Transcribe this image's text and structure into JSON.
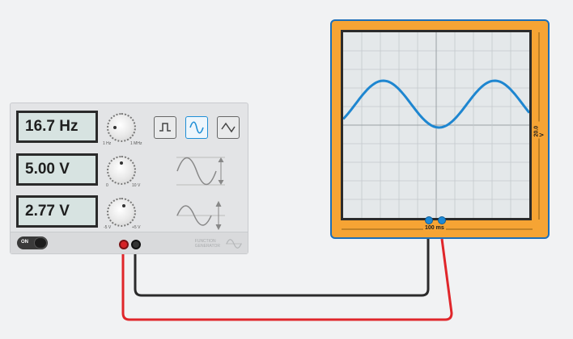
{
  "function_generator": {
    "frequency_display": "16.7 Hz",
    "amplitude_display": "5.00 V",
    "offset_display": "2.77 V",
    "frequency_knob": {
      "min_label": "1 Hz",
      "max_label": "1 MHz"
    },
    "amplitude_knob": {
      "min_label": "0",
      "max_label": "10 V"
    },
    "offset_knob": {
      "min_label": "-5 V",
      "max_label": "+5 V"
    },
    "waveforms": [
      {
        "icon": "square-wave-icon",
        "active": false
      },
      {
        "icon": "sine-wave-icon",
        "active": true
      },
      {
        "icon": "triangle-wave-icon",
        "active": false
      }
    ],
    "power_label": "ON",
    "brand_line1": "FUNCTION",
    "brand_line2": "GENERATOR"
  },
  "oscilloscope": {
    "time_per_division": "100 ms",
    "volts_range": "20.0 V"
  },
  "wires": {
    "colors": {
      "positive": "#e0262a",
      "negative": "#2b2b2b"
    }
  }
}
